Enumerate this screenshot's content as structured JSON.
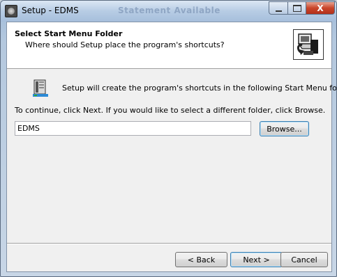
{
  "window": {
    "title": "Setup - EDMS",
    "background_title": "Statement Available",
    "controls": {
      "minimize": "minimize-icon",
      "maximize": "maximize-icon",
      "close": "close-icon",
      "close_glyph": "X"
    }
  },
  "header": {
    "title": "Select Start Menu Folder",
    "subtitle": "Where should Setup place the program's shortcuts?",
    "icon": "setup-computer-icon"
  },
  "body": {
    "folder_icon": "program-group-icon",
    "intro_text": "Setup will create the program's shortcuts in the following Start Menu folder.",
    "continue_text": "To continue, click Next. If you would like to select a different folder, click Browse.",
    "folder_value": "EDMS",
    "browse_label": "Browse..."
  },
  "footer": {
    "back_label": "< Back",
    "next_label": "Next >",
    "cancel_label": "Cancel"
  },
  "colors": {
    "accent_border": "#3c7fb1",
    "close_button": "#c9452a",
    "header_bg": "#ffffff",
    "client_bg": "#f0f0f0"
  }
}
